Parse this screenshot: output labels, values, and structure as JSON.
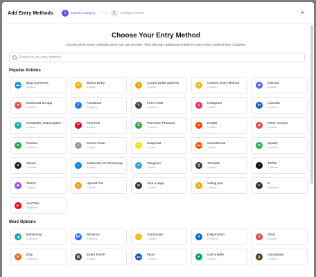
{
  "header": {
    "title": "Add Entry Methods",
    "steps": [
      {
        "num": "1",
        "label": "Choose Category"
      },
      {
        "num": "2",
        "label": "Configure Details"
      }
    ],
    "close": "×"
  },
  "main": {
    "title": "Choose Your Entry Method",
    "subtitle": "Choose which entry methods users can use to enter. They will earn additional entries for each entry method they complete."
  },
  "search": {
    "placeholder": "Search for an entry method"
  },
  "sections": [
    {
      "title": "Popular Actions",
      "items": [
        {
          "name": "Blog Comment",
          "options": "1 option",
          "icon": "comment-icon",
          "glyph": "▬",
          "color": "#1d8fe8"
        },
        {
          "name": "Bonus Entry",
          "options": "1 option",
          "icon": "trophy-icon",
          "glyph": "▾",
          "color": "#f6b600"
        },
        {
          "name": "Crypto wallet address",
          "options": "1 option",
          "icon": "coin-icon",
          "glyph": "●",
          "color": "#f5a300"
        },
        {
          "name": "Custom Entry Method",
          "options": "1 option",
          "icon": "bulb-icon",
          "glyph": "●",
          "color": "#f3bb1b"
        },
        {
          "name": "Discord",
          "options": "1 option",
          "icon": "discord-icon",
          "glyph": "◉",
          "color": "#5865f2"
        },
        {
          "name": "Download an app",
          "options": "1 option",
          "icon": "download-icon",
          "glyph": "▼",
          "color": "#ef4a4a"
        },
        {
          "name": "Facebook",
          "options": "4 options",
          "icon": "facebook-icon",
          "glyph": "f",
          "color": "#1877f2"
        },
        {
          "name": "Form Field",
          "options": "6 options",
          "icon": "pencil-icon",
          "glyph": "✎",
          "color": "#444444"
        },
        {
          "name": "Instagram",
          "options": "1 option",
          "icon": "instagram-icon",
          "glyph": "◎",
          "color": "#e1306c"
        },
        {
          "name": "LinkedIn",
          "options": "1 option",
          "icon": "linkedin-icon",
          "glyph": "in",
          "color": "#0a66c2"
        },
        {
          "name": "Newsletter Subscription",
          "options": "1 option",
          "icon": "mail-icon",
          "glyph": "✉",
          "color": "#1aa8b8"
        },
        {
          "name": "Pinterest",
          "options": "1 option",
          "icon": "pinterest-icon",
          "glyph": "P",
          "color": "#e60023"
        },
        {
          "name": "Purchase Products",
          "options": "2 options",
          "icon": "dollar-icon",
          "glyph": "$",
          "color": "#2aa84a"
        },
        {
          "name": "Reddit",
          "options": "1 option",
          "icon": "reddit-icon",
          "glyph": "●",
          "color": "#ff4500"
        },
        {
          "name": "Refer a friend",
          "options": "1 option",
          "icon": "users-icon",
          "glyph": "◆",
          "color": "#e84545"
        },
        {
          "name": "Review",
          "options": "1 option",
          "icon": "star-icon",
          "glyph": "★",
          "color": "#27a844"
        },
        {
          "name": "Secret Code",
          "options": "1 option",
          "icon": "lock-icon",
          "glyph": "▪",
          "color": "#9c9c9c"
        },
        {
          "name": "Snapchat",
          "options": "1 option",
          "icon": "snapchat-icon",
          "glyph": "●",
          "color": "#f7e600"
        },
        {
          "name": "SoundCloud",
          "options": "1 option",
          "icon": "soundcloud-icon",
          "glyph": "▬",
          "color": "#ff5500"
        },
        {
          "name": "Spotify",
          "options": "1 option",
          "icon": "spotify-icon",
          "glyph": "≋",
          "color": "#1db954"
        },
        {
          "name": "Steam",
          "options": "2 options",
          "icon": "steam-icon",
          "glyph": "●",
          "color": "#1b2838"
        },
        {
          "name": "Subscribe On Messenger",
          "options": "1 option",
          "icon": "messenger-icon",
          "glyph": "⚡",
          "color": "#0084ff"
        },
        {
          "name": "Telegram",
          "options": "1 option",
          "icon": "telegram-icon",
          "glyph": "➤",
          "color": "#2aa3df"
        },
        {
          "name": "Threads",
          "options": "1 option",
          "icon": "threads-icon",
          "glyph": "@",
          "color": "#333333"
        },
        {
          "name": "TikTok",
          "options": "7 options",
          "icon": "tiktok-icon",
          "glyph": "♪",
          "color": "#111111"
        },
        {
          "name": "Twitch",
          "options": "1 option",
          "icon": "twitch-icon",
          "glyph": "▣",
          "color": "#9146ff"
        },
        {
          "name": "Upload File",
          "options": "1 option",
          "icon": "upload-icon",
          "glyph": "▲",
          "color": "#f39c12"
        },
        {
          "name": "Visit a page",
          "options": "1 option",
          "icon": "globe-icon",
          "glyph": "◍",
          "color": "#333333"
        },
        {
          "name": "Voting poll",
          "options": "1 option",
          "icon": "poll-icon",
          "glyph": "▤",
          "color": "#f0a500"
        },
        {
          "name": "X",
          "options": "8 options",
          "icon": "x-icon",
          "glyph": "✕",
          "color": "#333333"
        },
        {
          "name": "YouTube",
          "options": "4 options",
          "icon": "youtube-icon",
          "glyph": "▶",
          "color": "#ff0000"
        }
      ]
    },
    {
      "title": "More Options",
      "items": [
        {
          "name": "Bandcamp",
          "options": "4 options",
          "icon": "bandcamp-icon",
          "glyph": "◢",
          "color": "#1da0c3"
        },
        {
          "name": "Behance",
          "options": "2 options",
          "icon": "behance-icon",
          "glyph": "Bē",
          "color": "#1769ff"
        },
        {
          "name": "Clubhouse",
          "options": "1 option",
          "icon": "clubhouse-icon",
          "glyph": "✋",
          "color": "#f1c40f"
        },
        {
          "name": "Dailymotion",
          "options": "2 options",
          "icon": "dailymotion-icon",
          "glyph": "d",
          "color": "#0066dc"
        },
        {
          "name": "dDex",
          "options": "1 option",
          "icon": "ddex-icon",
          "glyph": "d",
          "color": "#e74c3c"
        },
        {
          "name": "Etsy",
          "options": "2 options",
          "icon": "etsy-icon",
          "glyph": "E",
          "color": "#f1641e"
        },
        {
          "name": "Event RSVP",
          "options": "1 option",
          "icon": "calendar-icon",
          "glyph": "▦",
          "color": "#444444"
        },
        {
          "name": "Flickr",
          "options": "1 option",
          "icon": "flickr-icon",
          "glyph": "▬",
          "color": "#1155cc"
        },
        {
          "name": "GoFundMe",
          "options": "1 option",
          "icon": "gofundme-icon",
          "glyph": "♥",
          "color": "#02a95c"
        },
        {
          "name": "Goodreads",
          "options": "1 option",
          "icon": "goodreads-icon",
          "glyph": "g",
          "color": "#5a3e1b"
        }
      ]
    }
  ]
}
